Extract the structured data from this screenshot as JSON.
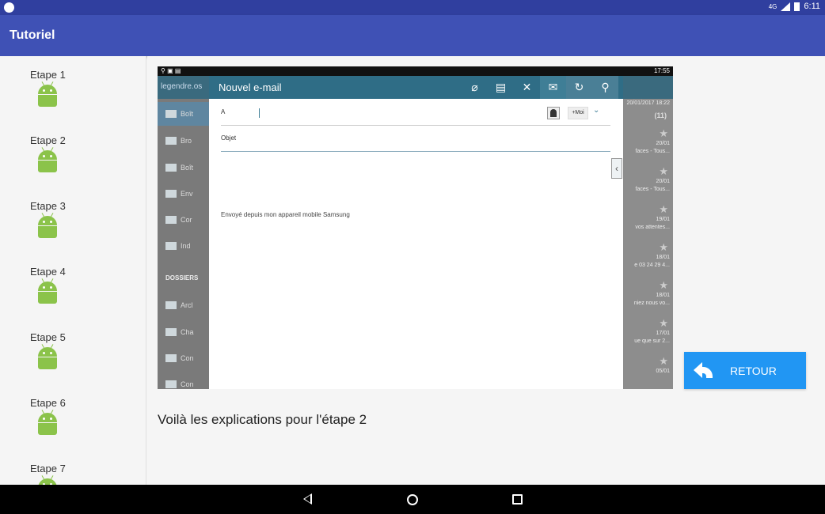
{
  "status_bar": {
    "time": "6:11",
    "network": "4G"
  },
  "app_bar": {
    "title": "Tutoriel"
  },
  "steps": [
    {
      "label": "Etape 1"
    },
    {
      "label": "Etape 2"
    },
    {
      "label": "Etape 3"
    },
    {
      "label": "Etape 4"
    },
    {
      "label": "Etape 5"
    },
    {
      "label": "Etape 6"
    },
    {
      "label": "Etape 7"
    }
  ],
  "tutorial_screenshot": {
    "status_time": "17:55",
    "account": "legendre.os",
    "compose_title": "Nouvel e-mail",
    "to_label": "A",
    "me_button": "+Moi",
    "subject_label": "Objet",
    "signature": "Envoyé depuis mon appareil mobile Samsung",
    "folders": [
      "Boît",
      "Bro",
      "Boît",
      "Env",
      "Cor",
      "Ind"
    ],
    "folders_header": "DOSSIERS",
    "custom_folders": [
      "Arcl",
      "Cha",
      "Con",
      "Con"
    ],
    "right_column": {
      "date": "20/01/2017 18:22",
      "count": "(11)",
      "items": [
        "20/01",
        "faces - Tous...",
        "20/01",
        "faces - Tous...",
        "19/01",
        "vos attentes...",
        "18/01",
        "e 03 24 29 4...",
        "18/01",
        "niez nous vo...",
        "17/01",
        "ue que sur 2...",
        "05/01"
      ]
    }
  },
  "explanation": "Voilà les explications pour l'étape 2",
  "retour_button": {
    "label": "RETOUR",
    "color": "#2196f3"
  },
  "colors": {
    "primary": "#3f51b5",
    "primary_dark": "#303f9f",
    "android_green": "#8bc34a"
  }
}
